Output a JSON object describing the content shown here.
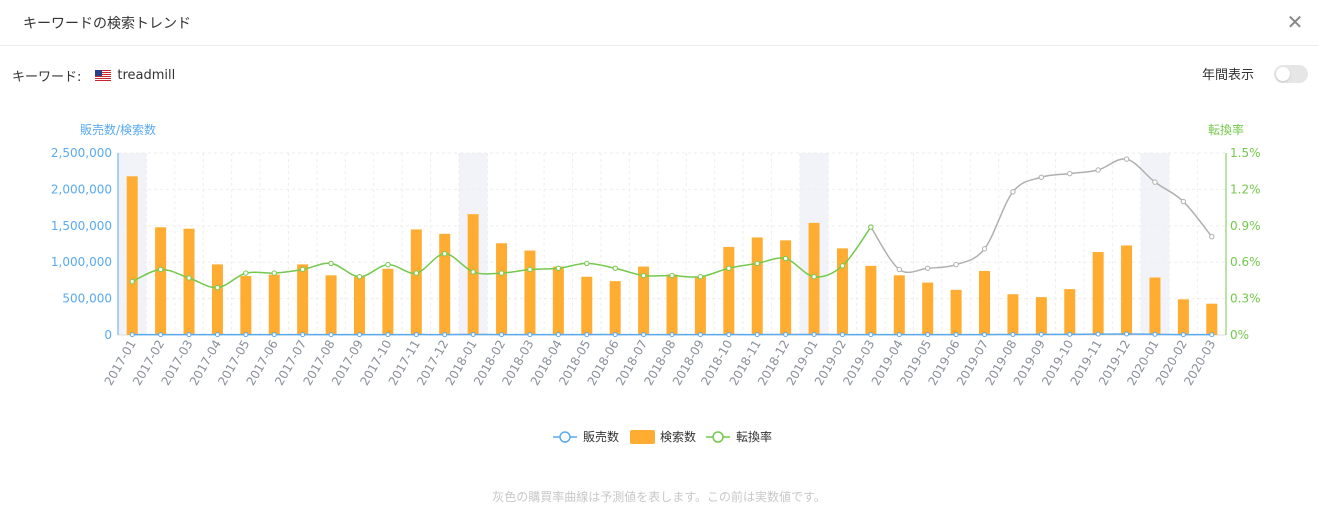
{
  "header": {
    "title": "キーワードの検索トレンド"
  },
  "keyword": {
    "label": "キーワード:",
    "flag_icon": "us-flag-icon",
    "value": "treadmill"
  },
  "annual_toggle": {
    "label": "年間表示",
    "on": false
  },
  "colors": {
    "search_bar": "#ffad32",
    "sales_line": "#5aaaf0",
    "conversion_line": "#74c94d",
    "forecast_line": "#b0b0b0",
    "highlight_band": "#f1f3f8"
  },
  "footnote": "灰色の購買率曲線は予測値を表します。この前は実数値です。",
  "chart_data": {
    "type": "bar",
    "left_axis_title": "販売数/検索数",
    "right_axis_title": "転換率",
    "left_ylim": [
      0,
      2500000
    ],
    "left_ticks": [
      "0",
      "500,000",
      "1,000,000",
      "1,500,000",
      "2,000,000",
      "2,500,000"
    ],
    "right_ylim": [
      0,
      1.5
    ],
    "right_ticks": [
      "0%",
      "0.3%",
      "0.6%",
      "0.9%",
      "1.2%",
      "1.5%"
    ],
    "grid": true,
    "legend_position": "bottom",
    "categories": [
      "2017-01",
      "2017-02",
      "2017-03",
      "2017-04",
      "2017-05",
      "2017-06",
      "2017-07",
      "2017-08",
      "2017-09",
      "2017-10",
      "2017-11",
      "2017-12",
      "2018-01",
      "2018-02",
      "2018-03",
      "2018-04",
      "2018-05",
      "2018-06",
      "2018-07",
      "2018-08",
      "2018-09",
      "2018-10",
      "2018-11",
      "2018-12",
      "2019-01",
      "2019-02",
      "2019-03",
      "2019-04",
      "2019-05",
      "2019-06",
      "2019-07",
      "2019-08",
      "2019-09",
      "2019-10",
      "2019-11",
      "2019-12",
      "2020-01",
      "2020-02",
      "2020-03"
    ],
    "highlight_categories": [
      "2017-01",
      "2018-01",
      "2019-01",
      "2020-01"
    ],
    "series": [
      {
        "name": "販売数",
        "kind": "line",
        "axis": "left",
        "values": [
          5000,
          5000,
          5000,
          5000,
          5000,
          5000,
          6000,
          5000,
          5000,
          5000,
          6000,
          6000,
          7000,
          6000,
          6000,
          6000,
          6000,
          6000,
          5000,
          5000,
          5000,
          6000,
          6000,
          7000,
          7000,
          6000,
          6000,
          5000,
          5000,
          5000,
          6000,
          7000,
          8000,
          9000,
          12000,
          14000,
          9000,
          6000,
          5000
        ]
      },
      {
        "name": "検索数",
        "kind": "bar",
        "axis": "left",
        "values": [
          2180000,
          1480000,
          1460000,
          970000,
          810000,
          830000,
          970000,
          820000,
          800000,
          910000,
          1450000,
          1390000,
          1660000,
          1260000,
          1160000,
          940000,
          800000,
          740000,
          940000,
          830000,
          800000,
          1210000,
          1340000,
          1300000,
          1540000,
          1190000,
          950000,
          820000,
          720000,
          620000,
          880000,
          560000,
          520000,
          630000,
          1140000,
          1230000,
          790000,
          490000,
          430000
        ]
      },
      {
        "name": "転換率",
        "kind": "line",
        "axis": "right",
        "values": [
          0.44,
          0.54,
          0.47,
          0.39,
          0.51,
          0.51,
          0.54,
          0.59,
          0.48,
          0.58,
          0.51,
          0.67,
          0.52,
          0.51,
          0.54,
          0.55,
          0.59,
          0.55,
          0.49,
          0.49,
          0.48,
          0.55,
          0.59,
          0.63,
          0.48,
          0.57,
          0.89
        ]
      }
    ],
    "forecast": {
      "start_category": "2019-03",
      "values": [
        0.89,
        0.54,
        0.55,
        0.58,
        0.71,
        1.18,
        1.3,
        1.33,
        1.36,
        1.45,
        1.26,
        1.1,
        0.81
      ]
    }
  }
}
